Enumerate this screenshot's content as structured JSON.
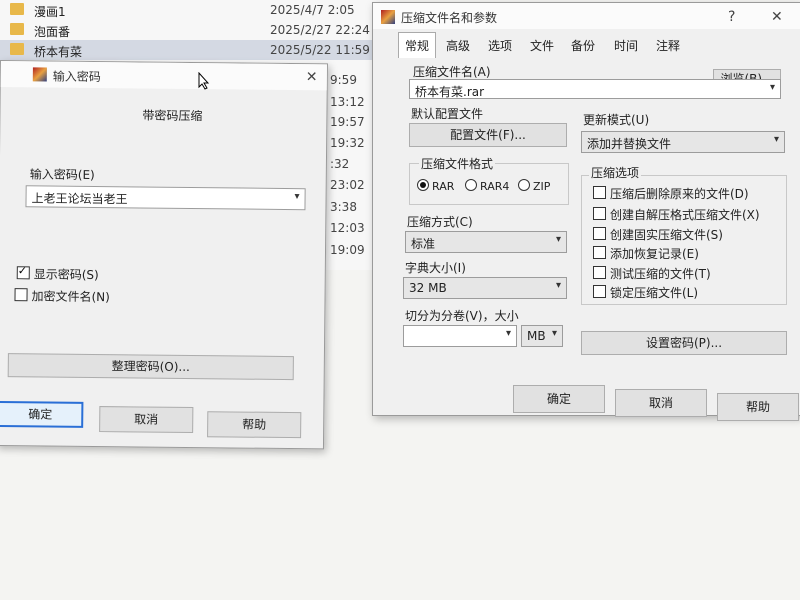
{
  "explorer": {
    "rows": [
      {
        "name": "漫画1",
        "date": "2025/4/7 2:05"
      },
      {
        "name": "泡面番",
        "date": "2025/2/27 22:24"
      },
      {
        "name": "桥本有菜",
        "date": "2025/5/22 11:59"
      }
    ],
    "peek_times": [
      "9:59",
      "13:12",
      "19:57",
      "19:32",
      ":32",
      "23:02",
      "3:38",
      "12:03",
      "19:09"
    ]
  },
  "password_dialog": {
    "title": "输入密码",
    "subtitle": "带密码压缩",
    "password_label": "输入密码(E)",
    "password_value": "上老王论坛当老王",
    "show_password_label": "显示密码(S)",
    "show_password_checked": true,
    "encrypt_names_label": "加密文件名(N)",
    "encrypt_names_checked": false,
    "organize_button": "整理密码(O)...",
    "ok": "确定",
    "cancel": "取消",
    "help": "帮助"
  },
  "archive_dialog": {
    "title": "压缩文件名和参数",
    "help_glyph": "?",
    "close_glyph": "✕",
    "tabs": [
      "常规",
      "高级",
      "选项",
      "文件",
      "备份",
      "时间",
      "注释"
    ],
    "archive_name_label": "压缩文件名(A)",
    "archive_name_value": "桥本有菜.rar",
    "browse_button": "浏览(B)...",
    "profile_label": "默认配置文件",
    "profile_button": "配置文件(F)...",
    "update_mode_label": "更新模式(U)",
    "update_mode_value": "添加并替换文件",
    "format_label": "压缩文件格式",
    "formats": [
      {
        "label": "RAR",
        "selected": true
      },
      {
        "label": "RAR4",
        "selected": false
      },
      {
        "label": "ZIP",
        "selected": false
      }
    ],
    "method_label": "压缩方式(C)",
    "method_value": "标准",
    "dict_label": "字典大小(I)",
    "dict_value": "32 MB",
    "split_label": "切分为分卷(V)，大小",
    "split_value": "",
    "split_unit": "MB",
    "options_label": "压缩选项",
    "options": [
      {
        "label": "压缩后删除原来的文件(D)",
        "checked": false
      },
      {
        "label": "创建自解压格式压缩文件(X)",
        "checked": false
      },
      {
        "label": "创建固实压缩文件(S)",
        "checked": false
      },
      {
        "label": "添加恢复记录(E)",
        "checked": false
      },
      {
        "label": "测试压缩的文件(T)",
        "checked": false
      },
      {
        "label": "锁定压缩文件(L)",
        "checked": false
      }
    ],
    "set_password_button": "设置密码(P)...",
    "ok": "确定",
    "cancel": "取消",
    "help": "帮助"
  }
}
